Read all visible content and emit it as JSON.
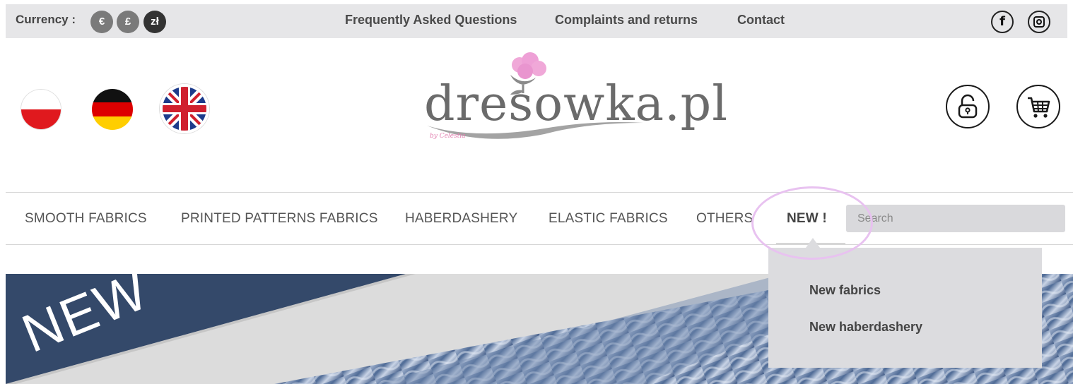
{
  "topbar": {
    "currency_label": "Currency :",
    "currencies": [
      "€",
      "£",
      "zł"
    ],
    "links": [
      "Frequently Asked Questions",
      "Complaints and returns",
      "Contact"
    ],
    "social": [
      "facebook-icon",
      "instagram-icon"
    ]
  },
  "header": {
    "languages": [
      "polish-flag",
      "german-flag",
      "uk-flag"
    ],
    "logo_text": "dresowka.pl",
    "logo_by": "by Celestia",
    "icons": [
      "lock-icon",
      "cart-icon"
    ]
  },
  "nav": {
    "items": [
      "SMOOTH FABRICS",
      "PRINTED PATTERNS FABRICS",
      "HABERDASHERY",
      "ELASTIC FABRICS",
      "OTHERS",
      "NEW !"
    ],
    "search_placeholder": "Search"
  },
  "dropdown": {
    "items": [
      "New fabrics",
      "New haberdashery"
    ]
  },
  "banner": {
    "label": "NEW"
  },
  "colors": {
    "topbar_bg": "#e6e6e8",
    "banner_navy": "#34496a",
    "highlight": "#e8c2f0",
    "dropdown_bg": "#dcdcdf"
  }
}
